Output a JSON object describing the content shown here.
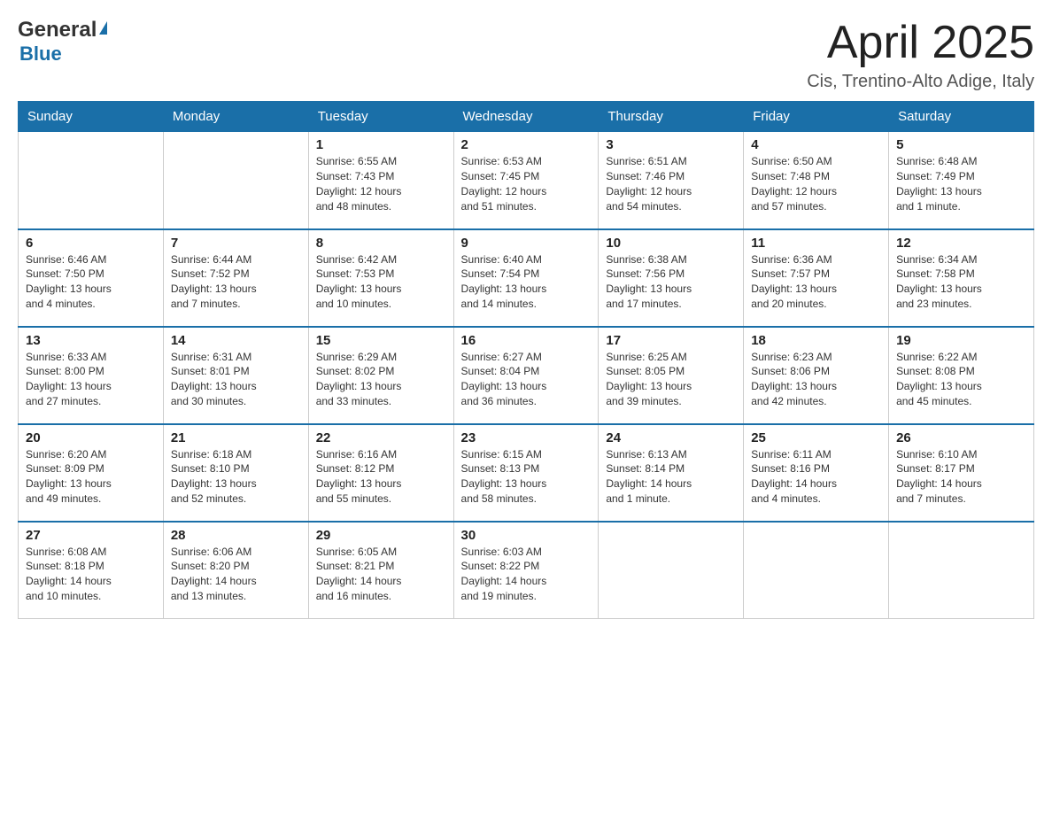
{
  "header": {
    "logo_general": "General",
    "logo_blue": "Blue",
    "month_title": "April 2025",
    "location": "Cis, Trentino-Alto Adige, Italy"
  },
  "days_of_week": [
    "Sunday",
    "Monday",
    "Tuesday",
    "Wednesday",
    "Thursday",
    "Friday",
    "Saturday"
  ],
  "weeks": [
    [
      {
        "day": "",
        "info": ""
      },
      {
        "day": "",
        "info": ""
      },
      {
        "day": "1",
        "info": "Sunrise: 6:55 AM\nSunset: 7:43 PM\nDaylight: 12 hours\nand 48 minutes."
      },
      {
        "day": "2",
        "info": "Sunrise: 6:53 AM\nSunset: 7:45 PM\nDaylight: 12 hours\nand 51 minutes."
      },
      {
        "day": "3",
        "info": "Sunrise: 6:51 AM\nSunset: 7:46 PM\nDaylight: 12 hours\nand 54 minutes."
      },
      {
        "day": "4",
        "info": "Sunrise: 6:50 AM\nSunset: 7:48 PM\nDaylight: 12 hours\nand 57 minutes."
      },
      {
        "day": "5",
        "info": "Sunrise: 6:48 AM\nSunset: 7:49 PM\nDaylight: 13 hours\nand 1 minute."
      }
    ],
    [
      {
        "day": "6",
        "info": "Sunrise: 6:46 AM\nSunset: 7:50 PM\nDaylight: 13 hours\nand 4 minutes."
      },
      {
        "day": "7",
        "info": "Sunrise: 6:44 AM\nSunset: 7:52 PM\nDaylight: 13 hours\nand 7 minutes."
      },
      {
        "day": "8",
        "info": "Sunrise: 6:42 AM\nSunset: 7:53 PM\nDaylight: 13 hours\nand 10 minutes."
      },
      {
        "day": "9",
        "info": "Sunrise: 6:40 AM\nSunset: 7:54 PM\nDaylight: 13 hours\nand 14 minutes."
      },
      {
        "day": "10",
        "info": "Sunrise: 6:38 AM\nSunset: 7:56 PM\nDaylight: 13 hours\nand 17 minutes."
      },
      {
        "day": "11",
        "info": "Sunrise: 6:36 AM\nSunset: 7:57 PM\nDaylight: 13 hours\nand 20 minutes."
      },
      {
        "day": "12",
        "info": "Sunrise: 6:34 AM\nSunset: 7:58 PM\nDaylight: 13 hours\nand 23 minutes."
      }
    ],
    [
      {
        "day": "13",
        "info": "Sunrise: 6:33 AM\nSunset: 8:00 PM\nDaylight: 13 hours\nand 27 minutes."
      },
      {
        "day": "14",
        "info": "Sunrise: 6:31 AM\nSunset: 8:01 PM\nDaylight: 13 hours\nand 30 minutes."
      },
      {
        "day": "15",
        "info": "Sunrise: 6:29 AM\nSunset: 8:02 PM\nDaylight: 13 hours\nand 33 minutes."
      },
      {
        "day": "16",
        "info": "Sunrise: 6:27 AM\nSunset: 8:04 PM\nDaylight: 13 hours\nand 36 minutes."
      },
      {
        "day": "17",
        "info": "Sunrise: 6:25 AM\nSunset: 8:05 PM\nDaylight: 13 hours\nand 39 minutes."
      },
      {
        "day": "18",
        "info": "Sunrise: 6:23 AM\nSunset: 8:06 PM\nDaylight: 13 hours\nand 42 minutes."
      },
      {
        "day": "19",
        "info": "Sunrise: 6:22 AM\nSunset: 8:08 PM\nDaylight: 13 hours\nand 45 minutes."
      }
    ],
    [
      {
        "day": "20",
        "info": "Sunrise: 6:20 AM\nSunset: 8:09 PM\nDaylight: 13 hours\nand 49 minutes."
      },
      {
        "day": "21",
        "info": "Sunrise: 6:18 AM\nSunset: 8:10 PM\nDaylight: 13 hours\nand 52 minutes."
      },
      {
        "day": "22",
        "info": "Sunrise: 6:16 AM\nSunset: 8:12 PM\nDaylight: 13 hours\nand 55 minutes."
      },
      {
        "day": "23",
        "info": "Sunrise: 6:15 AM\nSunset: 8:13 PM\nDaylight: 13 hours\nand 58 minutes."
      },
      {
        "day": "24",
        "info": "Sunrise: 6:13 AM\nSunset: 8:14 PM\nDaylight: 14 hours\nand 1 minute."
      },
      {
        "day": "25",
        "info": "Sunrise: 6:11 AM\nSunset: 8:16 PM\nDaylight: 14 hours\nand 4 minutes."
      },
      {
        "day": "26",
        "info": "Sunrise: 6:10 AM\nSunset: 8:17 PM\nDaylight: 14 hours\nand 7 minutes."
      }
    ],
    [
      {
        "day": "27",
        "info": "Sunrise: 6:08 AM\nSunset: 8:18 PM\nDaylight: 14 hours\nand 10 minutes."
      },
      {
        "day": "28",
        "info": "Sunrise: 6:06 AM\nSunset: 8:20 PM\nDaylight: 14 hours\nand 13 minutes."
      },
      {
        "day": "29",
        "info": "Sunrise: 6:05 AM\nSunset: 8:21 PM\nDaylight: 14 hours\nand 16 minutes."
      },
      {
        "day": "30",
        "info": "Sunrise: 6:03 AM\nSunset: 8:22 PM\nDaylight: 14 hours\nand 19 minutes."
      },
      {
        "day": "",
        "info": ""
      },
      {
        "day": "",
        "info": ""
      },
      {
        "day": "",
        "info": ""
      }
    ]
  ]
}
